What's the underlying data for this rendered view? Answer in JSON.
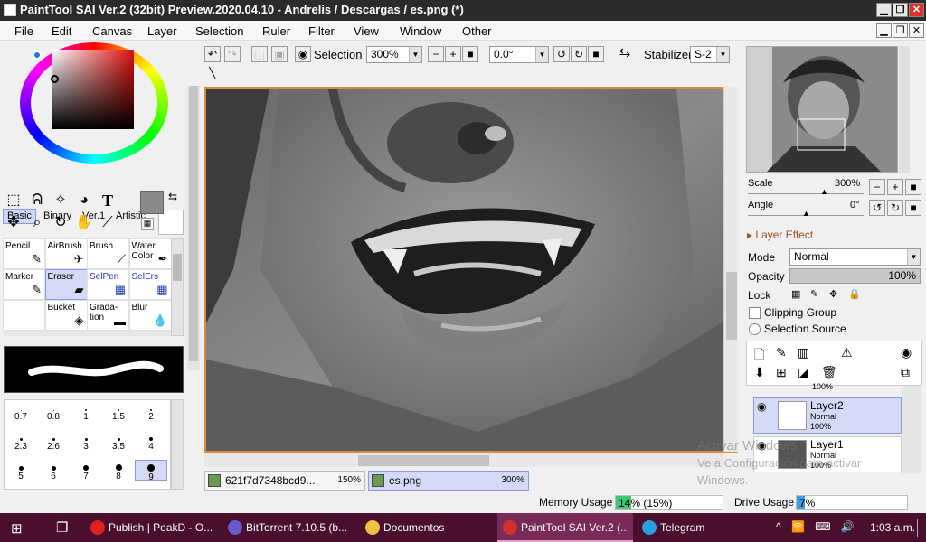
{
  "window": {
    "title": "PaintTool SAI Ver.2 (32bit) Preview.2020.04.10 - Andrelis / Descargas / es.png (*)",
    "minimize": "▁",
    "restore": "❐",
    "close": "✕"
  },
  "menu": [
    "File",
    "Edit",
    "Canvas",
    "Layer",
    "Selection",
    "Ruler",
    "Filter",
    "View",
    "Window",
    "Other"
  ],
  "color_tabs": [
    "Basic",
    "Binary",
    "Ver.1",
    "Artistic"
  ],
  "tool_icons": [
    "rect-select-icon",
    "lasso-icon",
    "magic-wand-icon",
    "fill-shape-icon",
    "text-icon",
    "move-icon",
    "zoom-icon",
    "rotate-icon",
    "hand-icon",
    "eyedropper-icon"
  ],
  "brushes": [
    {
      "name": "Pencil",
      "glyph": "✎",
      "blue": false,
      "sel": false
    },
    {
      "name": "AirBrush",
      "glyph": "✈",
      "blue": false,
      "sel": false
    },
    {
      "name": "Brush",
      "glyph": "⟋",
      "blue": false,
      "sel": false
    },
    {
      "name": "Water Color",
      "glyph": "✒",
      "blue": false,
      "sel": false
    },
    {
      "name": "Marker",
      "glyph": "✎",
      "blue": false,
      "sel": false
    },
    {
      "name": "Eraser",
      "glyph": "▰",
      "blue": false,
      "sel": true
    },
    {
      "name": "SelPen",
      "glyph": "▦",
      "blue": true,
      "sel": false
    },
    {
      "name": "SelErs",
      "glyph": "▦",
      "blue": true,
      "sel": false
    },
    {
      "name": "",
      "glyph": "",
      "blue": false,
      "sel": false
    },
    {
      "name": "Bucket",
      "glyph": "◈",
      "blue": false,
      "sel": false
    },
    {
      "name": "Grada-tion",
      "glyph": "▬",
      "blue": false,
      "sel": false
    },
    {
      "name": "Blur",
      "glyph": "💧",
      "blue": false,
      "sel": false
    }
  ],
  "brush_sizes": [
    {
      "label": "0.7",
      "d": 1
    },
    {
      "label": "0.8",
      "d": 1
    },
    {
      "label": "1",
      "d": 2
    },
    {
      "label": "1.5",
      "d": 2
    },
    {
      "label": "2",
      "d": 2
    },
    {
      "label": "2.3",
      "d": 3
    },
    {
      "label": "2.6",
      "d": 3
    },
    {
      "label": "3",
      "d": 3
    },
    {
      "label": "3.5",
      "d": 3
    },
    {
      "label": "4",
      "d": 4
    },
    {
      "label": "5",
      "d": 5
    },
    {
      "label": "6",
      "d": 5
    },
    {
      "label": "7",
      "d": 6
    },
    {
      "label": "8",
      "d": 7
    },
    {
      "label": "9",
      "d": 8
    }
  ],
  "toolbar": {
    "selection_label": "Selection",
    "zoom": "300%",
    "angle": "0.0°",
    "stabilizer_label": "Stabilizer",
    "stabilizer": "S-2"
  },
  "navigator": {
    "scale_label": "Scale",
    "scale": "300%",
    "angle_label": "Angle",
    "angle": "0°"
  },
  "layer_effect": "Layer Effect",
  "layer_props": {
    "mode_label": "Mode",
    "mode": "Normal",
    "opacity_label": "Opacity",
    "opacity": "100%",
    "lock_label": "Lock",
    "clipping": "Clipping Group",
    "selection_source": "Selection Source"
  },
  "layers": [
    {
      "name": "Layer2",
      "mode": "Normal",
      "opacity": "100%",
      "selected": true
    },
    {
      "name": "Layer1",
      "mode": "Normal",
      "opacity": "100%",
      "selected": false
    }
  ],
  "layer_partial": "100%",
  "watermark": {
    "l1": "Activar Windows",
    "l2": "Ve a Configuración para activar",
    "l3": "Windows."
  },
  "doc_tabs": [
    {
      "name": "621f7d7348bcd9...",
      "zoom": "150%",
      "active": false
    },
    {
      "name": "es.png",
      "zoom": "300%",
      "active": true
    }
  ],
  "status": {
    "memory_label": "Memory Usage",
    "memory_value": "14% (15%)",
    "memory_fraction": 0.14,
    "drive_label": "Drive Usage",
    "drive_value": "7%",
    "drive_fraction": 0.07
  },
  "taskbar": {
    "items": [
      {
        "label": "Publish | PeakD - O...",
        "color": "#e02020",
        "active": false
      },
      {
        "label": "BitTorrent 7.10.5 (b...",
        "color": "#6a5acd",
        "active": false
      },
      {
        "label": "Documentos",
        "color": "#f0c040",
        "active": false
      },
      {
        "label": "PaintTool SAI Ver.2 (...",
        "color": "#d03030",
        "active": true
      },
      {
        "label": "Telegram",
        "color": "#2aa0e0",
        "active": false
      }
    ],
    "time": "1:03 a.m.",
    "tray": "^ 🛜 ⌨ 🔊"
  }
}
